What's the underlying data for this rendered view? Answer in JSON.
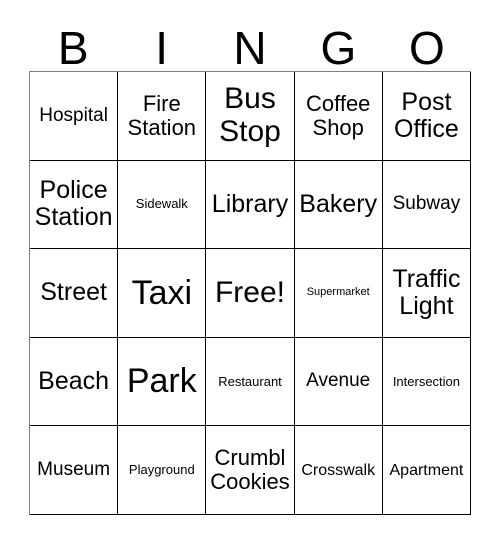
{
  "card": {
    "header": {
      "letters": [
        "B",
        "I",
        "N",
        "G",
        "O"
      ]
    },
    "rows": [
      [
        {
          "label": "Hospital",
          "size": "fs-lg"
        },
        {
          "label": "Fire Station",
          "size": "fs-xl"
        },
        {
          "label": "Bus Stop",
          "size": "fs-3xl"
        },
        {
          "label": "Coffee Shop",
          "size": "fs-xl"
        },
        {
          "label": "Post Office",
          "size": "fs-2xl"
        }
      ],
      [
        {
          "label": "Police Station",
          "size": "fs-2xl"
        },
        {
          "label": "Sidewalk",
          "size": "fs-sm"
        },
        {
          "label": "Library",
          "size": "fs-2xl"
        },
        {
          "label": "Bakery",
          "size": "fs-2xl"
        },
        {
          "label": "Subway",
          "size": "fs-lg"
        }
      ],
      [
        {
          "label": "Street",
          "size": "fs-2xl"
        },
        {
          "label": "Taxi",
          "size": "fs-4xl"
        },
        {
          "label": "Free!",
          "size": "fs-3xl"
        },
        {
          "label": "Supermarket",
          "size": "fs-xs"
        },
        {
          "label": "Traffic Light",
          "size": "fs-2xl"
        }
      ],
      [
        {
          "label": "Beach",
          "size": "fs-2xl"
        },
        {
          "label": "Park",
          "size": "fs-4xl"
        },
        {
          "label": "Restaurant",
          "size": "fs-sm"
        },
        {
          "label": "Avenue",
          "size": "fs-lg"
        },
        {
          "label": "Intersection",
          "size": "fs-sm"
        }
      ],
      [
        {
          "label": "Museum",
          "size": "fs-lg"
        },
        {
          "label": "Playground",
          "size": "fs-sm"
        },
        {
          "label": "Crumbl Cookies",
          "size": "fs-xl"
        },
        {
          "label": "Crosswalk",
          "size": "fs-md"
        },
        {
          "label": "Apartment",
          "size": "fs-md"
        }
      ]
    ],
    "colors": {
      "background": "#ffffff",
      "text": "#000000",
      "grid_line": "#000000",
      "grid_outer_line": "#808080"
    }
  }
}
